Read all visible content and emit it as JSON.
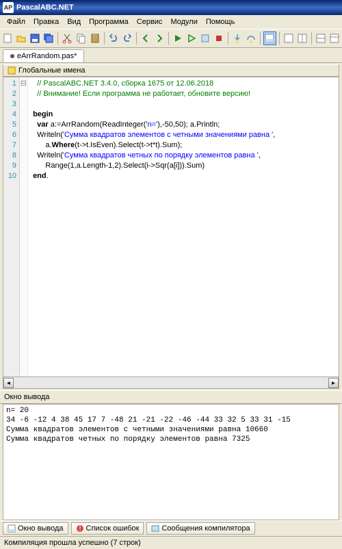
{
  "window": {
    "title": "PascalABC.NET",
    "icon_label": "AP"
  },
  "menu": {
    "items": [
      "Файл",
      "Правка",
      "Вид",
      "Программа",
      "Сервис",
      "Модули",
      "Помощь"
    ]
  },
  "tab": {
    "filename": "eArrRandom.pas*"
  },
  "globals_bar": {
    "label": "Глобальные имена"
  },
  "editor": {
    "lines": [
      {
        "n": "1",
        "pre": "   ",
        "seg": [
          [
            "comment",
            "// PascalABC.NET 3.4.0, сборка 1675 от 12.06.2018"
          ]
        ]
      },
      {
        "n": "2",
        "pre": "   ",
        "seg": [
          [
            "comment",
            "// Внимание! Если программа не работает, обновите версию!"
          ]
        ]
      },
      {
        "n": "3",
        "pre": "",
        "seg": []
      },
      {
        "n": "4",
        "fold": "⊟",
        "pre": " ",
        "seg": [
          [
            "keyword",
            "begin"
          ]
        ]
      },
      {
        "n": "5",
        "pre": "   ",
        "seg": [
          [
            "keyword",
            "var"
          ],
          [
            "ident",
            " a:=ArrRandom(ReadInteger("
          ],
          [
            "string",
            "'n='"
          ],
          [
            "ident",
            "),-50,50); a.Println;"
          ]
        ]
      },
      {
        "n": "6",
        "pre": "   ",
        "seg": [
          [
            "ident",
            "Writeln("
          ],
          [
            "string",
            "'Сумма квадратов элементов с четными значениями равна '"
          ],
          [
            "ident",
            ","
          ]
        ]
      },
      {
        "n": "7",
        "pre": "       ",
        "seg": [
          [
            "ident",
            "a."
          ],
          [
            "keyword",
            "Where"
          ],
          [
            "ident",
            "(t->t.IsEven).Select(t->t*t).Sum);"
          ]
        ]
      },
      {
        "n": "8",
        "pre": "   ",
        "seg": [
          [
            "ident",
            "Writeln("
          ],
          [
            "string",
            "'Сумма квадратов четных по порядку элементов равна '"
          ],
          [
            "ident",
            ","
          ]
        ]
      },
      {
        "n": "9",
        "pre": "       ",
        "seg": [
          [
            "ident",
            "Range(1,a.Length-1,2).Select(i->Sqr(a[i])).Sum)"
          ]
        ]
      },
      {
        "n": "10",
        "pre": " ",
        "seg": [
          [
            "keyword",
            "end"
          ],
          [
            "ident",
            "."
          ]
        ]
      }
    ]
  },
  "output": {
    "title": "Окно вывода",
    "text": "n= 20\n34 -6 -12 4 38 45 17 7 -48 21 -21 -22 -46 -44 33 32 5 33 31 -15\nСумма квадратов элементов с четными значениями равна 10660\nСумма квадратов четных по порядку элементов равна 7325"
  },
  "bottom_tabs": {
    "items": [
      {
        "label": "Окно вывода"
      },
      {
        "label": "Список ошибок"
      },
      {
        "label": "Сообщения компилятора"
      }
    ]
  },
  "status": {
    "text": "Компиляция прошла успешно (7 строк)"
  }
}
